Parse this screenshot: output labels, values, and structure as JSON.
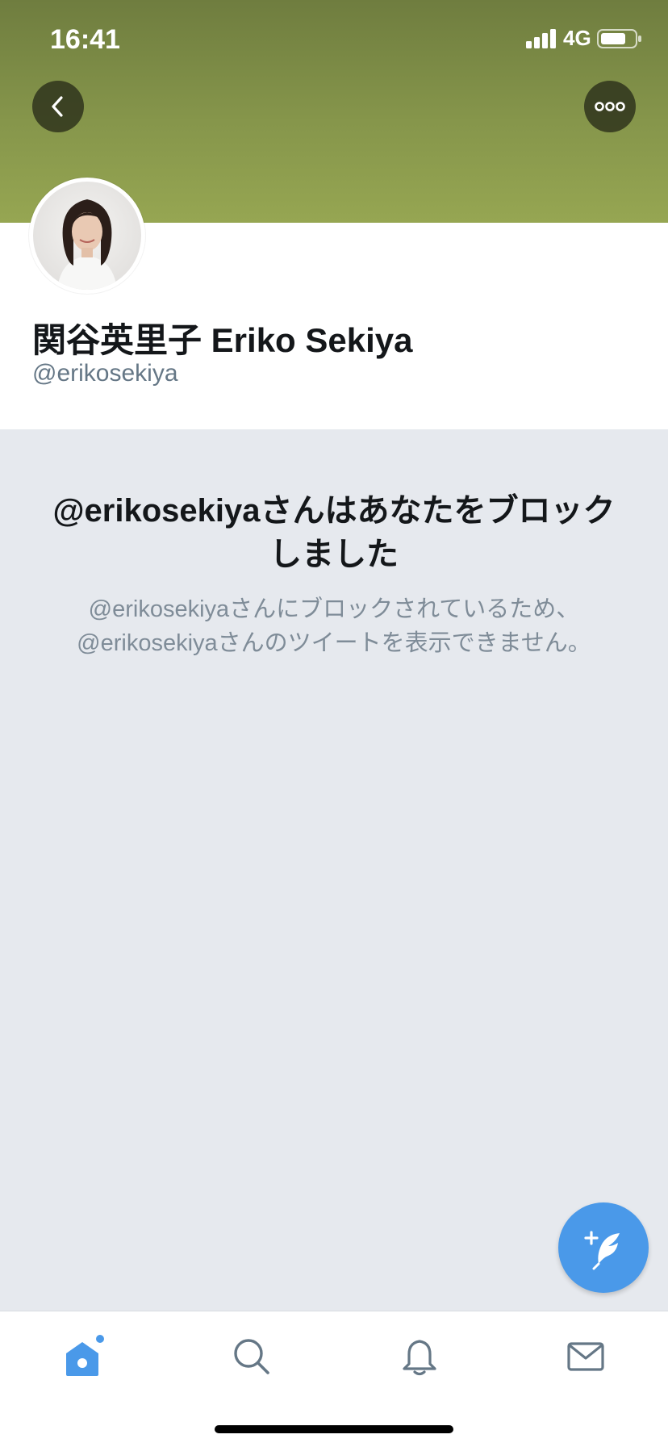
{
  "status_bar": {
    "time": "16:41",
    "network": "4G"
  },
  "profile": {
    "display_name": "関谷英里子 Eriko Sekiya",
    "handle": "@erikosekiya"
  },
  "blocked": {
    "title": "@erikosekiyaさんはあなたをブロックしました",
    "description_line1": "@erikosekiyaさんにブロックされているため、",
    "description_line2": "@erikosekiyaさんのツイートを表示できません。"
  },
  "colors": {
    "accent": "#4a99e9",
    "banner_top": "#6f7d3f",
    "banner_bottom": "#96a652",
    "background": "#e6e9ee"
  },
  "icons": {
    "back": "chevron-left-icon",
    "more": "ellipsis-icon",
    "compose": "compose-tweet-icon",
    "home": "home-icon",
    "search": "search-icon",
    "notifications": "bell-icon",
    "messages": "mail-icon"
  }
}
